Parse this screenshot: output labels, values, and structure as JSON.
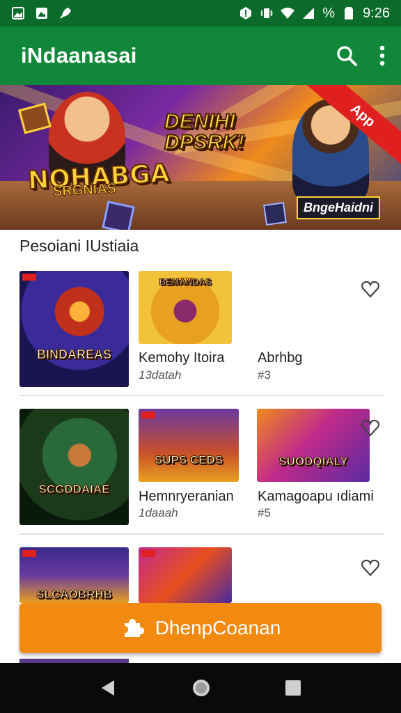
{
  "status_bar": {
    "time": "9:26",
    "battery_label": "%"
  },
  "app_bar": {
    "title": "iNdaanasai"
  },
  "banner": {
    "left_title": "NOHABGA",
    "left_subtitle": "SRGNIAS",
    "center_title": "DENIHI DPSRK!",
    "ribbon": "App",
    "right_tag": "BngeHaidni"
  },
  "section": {
    "title": "Pesoiani IUstiaia"
  },
  "rows": [
    {
      "items": [
        {
          "thumb_label": "BINDAREAS",
          "title": "",
          "sub": ""
        },
        {
          "thumb_label": "BEMANDAS",
          "title": "Kemohy Itoira",
          "sub": "13datah"
        },
        {
          "thumb_label": "",
          "title": "Abrhbg",
          "sub": "#3"
        }
      ]
    },
    {
      "items": [
        {
          "thumb_label": "SCGDDAIAE",
          "title": "",
          "sub": ""
        },
        {
          "thumb_label": "SUPS CEDS",
          "title": "Hemnryeranian",
          "sub": "1daaah"
        },
        {
          "thumb_label": "SUODQIALY",
          "title": "Kamagoapu ıdiami",
          "sub": "#5"
        }
      ]
    },
    {
      "items": [
        {
          "thumb_label": "SLCAOBRHB",
          "title": "",
          "sub": ""
        },
        {
          "thumb_label": "",
          "title": "",
          "sub": ""
        },
        {
          "thumb_label": "",
          "title": "",
          "sub": ""
        }
      ]
    }
  ],
  "fab": {
    "label": "DhenpCoanan",
    "icon": "puzzle-icon"
  },
  "colors": {
    "status_bar": "#0b6b2a",
    "app_bar": "#11873a",
    "fab": "#f28a12"
  }
}
